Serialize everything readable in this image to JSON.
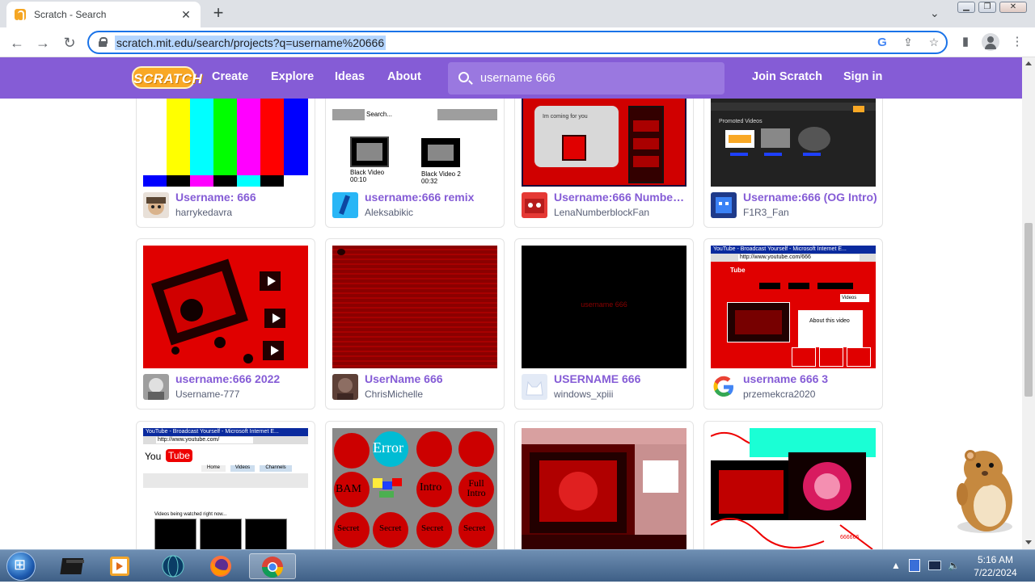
{
  "browser": {
    "tab_title": "Scratch - Search",
    "new_tab": "+",
    "tab_close": "✕",
    "url": "scratch.mit.edu/search/projects?q=username%20666"
  },
  "nav": {
    "logo": "SCRATCH",
    "links": [
      "Create",
      "Explore",
      "Ideas",
      "About"
    ],
    "search_value": "username 666",
    "join": "Join Scratch",
    "signin": "Sign in"
  },
  "projects": [
    {
      "title": "Username: 666",
      "author": "harrykedavra"
    },
    {
      "title": "username:666 remix",
      "author": "Aleksabikic"
    },
    {
      "title": "Username:666 Numberblocks",
      "author": "LenaNumberblockFan"
    },
    {
      "title": "Username:666 (OG Intro)",
      "author": "F1R3_Fan"
    },
    {
      "title": "username:666 2022",
      "author": "Username-777"
    },
    {
      "title": "UserName 666",
      "author": "ChrisMichelle"
    },
    {
      "title": "USERNAME 666",
      "author": "windows_xpiii"
    },
    {
      "title": "username 666 3",
      "author": "przemekcra2020"
    },
    {
      "title": "",
      "author": ""
    },
    {
      "title": "",
      "author": ""
    },
    {
      "title": "",
      "author": ""
    },
    {
      "title": "",
      "author": ""
    }
  ],
  "thumb_text": {
    "search_label": "Search...",
    "video1": "Black Video",
    "video1_time": "00:10",
    "video2": "Black Video 2",
    "video2_time": "00:32",
    "coming": "Im coming for you",
    "promoted": "Promoted Videos",
    "username_text": "username 666",
    "yt_window": "YouTube - Broadcast Yourself - Microsoft Internet E...",
    "yt_url": "http://www.youtube.com/666",
    "yt_url2": "http://www.youtube.com/",
    "you": "You",
    "tube": "Tube",
    "about_video": "About this video",
    "videos_label": "Videos",
    "home_label": "Home",
    "channels_label": "Channels",
    "watched": "Videos being watched right now...",
    "error": "Error",
    "intro": "Intro",
    "full_intro": "Full Intro",
    "bam": "BAM",
    "secret": "Secret",
    "beta": "666666"
  },
  "taskbar": {
    "time": "5:16 AM",
    "date": "7/22/2024"
  },
  "colors": {
    "scratch_purple": "#855cd6",
    "title_purple": "#855cd6",
    "author_gray": "#575e75"
  }
}
